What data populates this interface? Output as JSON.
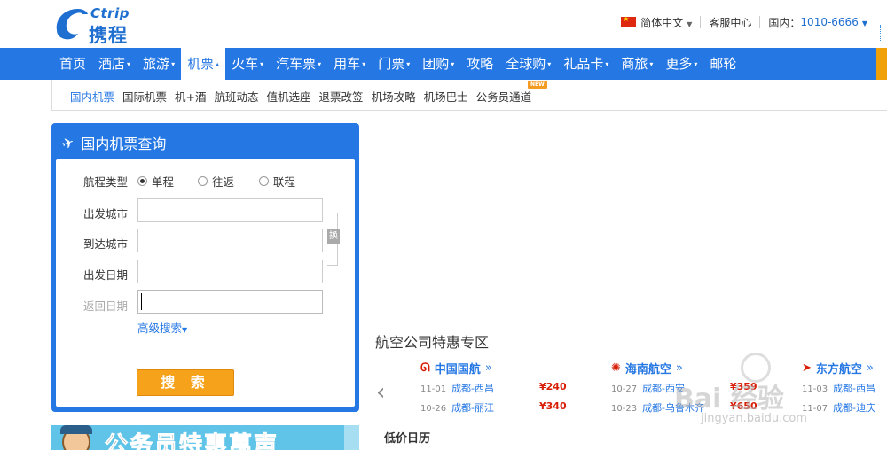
{
  "logo": {
    "brand_en": "Ctrip",
    "brand_cn": "携程"
  },
  "topbar": {
    "language": "简体中文",
    "service": "客服中心",
    "phone_label": "国内：",
    "phone": "1010-6666"
  },
  "mainnav": {
    "items": [
      {
        "label": "首页",
        "arrow": ""
      },
      {
        "label": "酒店",
        "arrow": "▾"
      },
      {
        "label": "旅游",
        "arrow": "▾"
      },
      {
        "label": "机票",
        "arrow": "▴"
      },
      {
        "label": "火车",
        "arrow": "▾"
      },
      {
        "label": "汽车票",
        "arrow": "▾"
      },
      {
        "label": "用车",
        "arrow": "▾"
      },
      {
        "label": "门票",
        "arrow": "▾"
      },
      {
        "label": "团购",
        "arrow": "▾"
      },
      {
        "label": "攻略",
        "arrow": ""
      },
      {
        "label": "全球购",
        "arrow": "▾"
      },
      {
        "label": "礼品卡",
        "arrow": "▾"
      },
      {
        "label": "商旅",
        "arrow": "▾"
      },
      {
        "label": "更多",
        "arrow": "▾"
      },
      {
        "label": "邮轮",
        "arrow": ""
      }
    ],
    "active_index": 3
  },
  "subnav": {
    "items": [
      "国内机票",
      "国际机票",
      "机+酒",
      "航班动态",
      "值机选座",
      "退票改签",
      "机场攻略",
      "机场巴士",
      "公务员通道"
    ],
    "new_badge": "NEW"
  },
  "search": {
    "title": "国内机票查询",
    "trip_type_label": "航程类型",
    "trip_types": [
      "单程",
      "往返",
      "联程"
    ],
    "selected_trip_type": "单程",
    "from_label": "出发城市",
    "to_label": "到达城市",
    "depart_label": "出发日期",
    "return_label": "返回日期",
    "swap_label": "换",
    "advanced": "高级搜索",
    "submit": "搜 索"
  },
  "banner": {
    "text": "公务员特惠萬声"
  },
  "specials": {
    "title": "航空公司特惠专区",
    "airlines": [
      {
        "name": "中国国航",
        "routes": [
          {
            "date": "11-01",
            "route": "成都-西昌",
            "price": "¥240"
          },
          {
            "date": "10-26",
            "route": "成都-丽江",
            "price": "¥340"
          }
        ]
      },
      {
        "name": "海南航空",
        "routes": [
          {
            "date": "10-27",
            "route": "成都-西安",
            "price": "¥359"
          },
          {
            "date": "10-23",
            "route": "成都-乌鲁木齐",
            "price": "¥650"
          }
        ]
      },
      {
        "name": "东方航空",
        "routes": [
          {
            "date": "11-03",
            "route": "成都-西昌",
            "price": ""
          },
          {
            "date": "11-07",
            "route": "成都-迪庆",
            "price": ""
          }
        ]
      }
    ]
  },
  "low_calendar": "低价日历",
  "watermark": {
    "main": "Bai 经验",
    "sub": "jingyan.baidu.com"
  }
}
